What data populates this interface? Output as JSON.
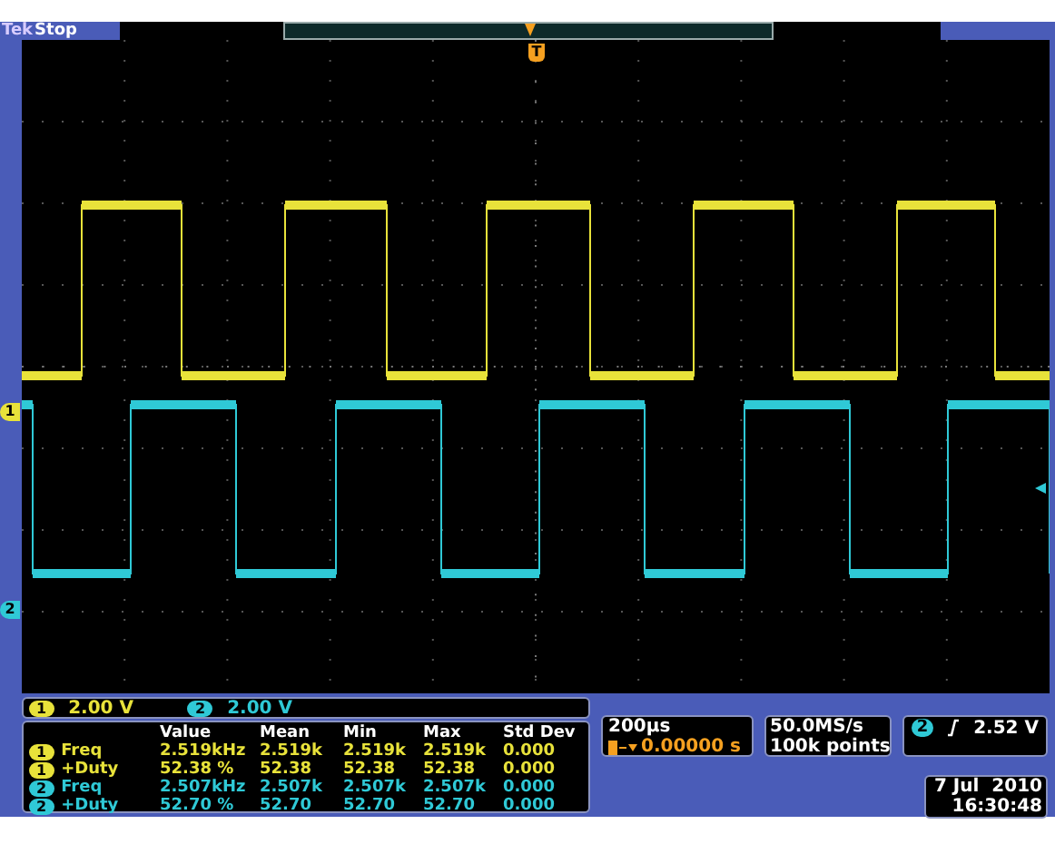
{
  "header": {
    "brand": "Tek",
    "status": "Stop"
  },
  "markers": [
    {
      "label": "1",
      "color": "#e8e23a"
    },
    {
      "label": "2",
      "color": "#2fc9d6"
    }
  ],
  "trigger_marker": "T",
  "channels": [
    {
      "label": "1",
      "scale": "2.00 V",
      "color": "#e8e23a"
    },
    {
      "label": "2",
      "scale": "2.00 V",
      "color": "#2fc9d6"
    }
  ],
  "measurements": {
    "columns": [
      "Value",
      "Mean",
      "Min",
      "Max",
      "Std Dev"
    ],
    "rows": [
      {
        "channel": "1",
        "color": "#e8e23a",
        "name": "Freq",
        "cells": [
          "2.519kHz",
          "2.519k",
          "2.519k",
          "2.519k",
          "0.000"
        ]
      },
      {
        "channel": "1",
        "color": "#e8e23a",
        "name": "+Duty",
        "cells": [
          "52.38 %",
          "52.38",
          "52.38",
          "52.38",
          "0.000"
        ]
      },
      {
        "channel": "2",
        "color": "#2fc9d6",
        "name": "Freq",
        "cells": [
          "2.507kHz",
          "2.507k",
          "2.507k",
          "2.507k",
          "0.000"
        ]
      },
      {
        "channel": "2",
        "color": "#2fc9d6",
        "name": "+Duty",
        "cells": [
          "52.70 %",
          "52.70",
          "52.70",
          "52.70",
          "0.000"
        ]
      }
    ]
  },
  "timebase": {
    "scale": "200µs",
    "position": "0.00000 s"
  },
  "acquisition": {
    "sample_rate": "50.0MS/s",
    "record_length": "100k points"
  },
  "trigger": {
    "channel": "2",
    "color": "#2fc9d6",
    "level": "2.52 V"
  },
  "timestamp": {
    "date": "7 Jul  2010",
    "time": "16:30:48"
  }
}
